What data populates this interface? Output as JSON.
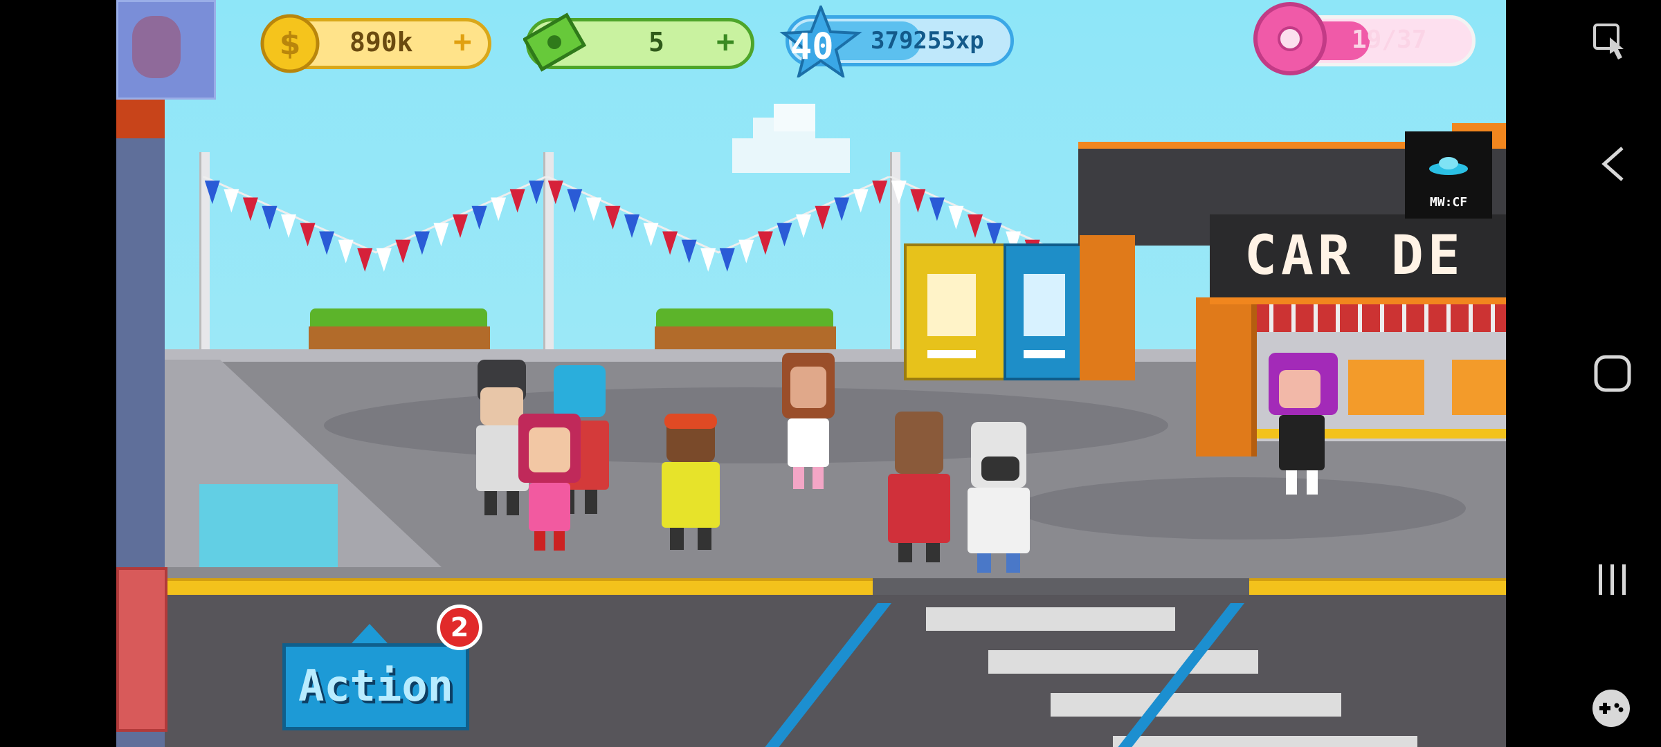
{
  "hud": {
    "coins": "890k",
    "cash": "5",
    "level": "40",
    "xp": "379255xp",
    "xp_progress": 0.6,
    "donuts": "19/37",
    "donut_progress": 0.51
  },
  "dealer": {
    "sign": "CAR DE",
    "logo_text": "MW:CF"
  },
  "action": {
    "label": "Action",
    "badge": "2"
  },
  "colors": {
    "coin": "#f5c41c",
    "cash": "#67c93a",
    "xp": "#3aa7e6",
    "donut": "#f05aa8",
    "accent_orange": "#f1861e"
  },
  "icons": [
    "coin-icon",
    "cash-icon",
    "level-star-icon",
    "donut-icon",
    "wrench-icon",
    "hand-cursor-icon",
    "back-icon",
    "home-icon",
    "recents-icon",
    "gamepad-icon"
  ]
}
